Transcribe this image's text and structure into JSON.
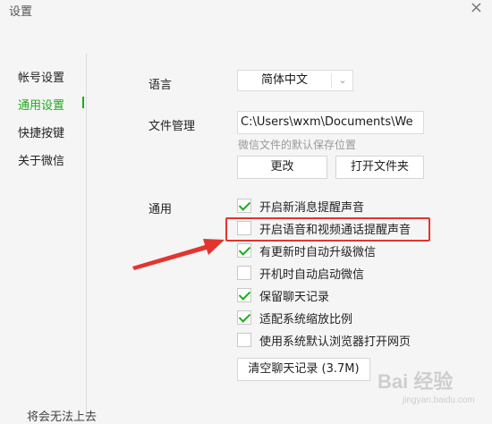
{
  "window": {
    "title": "设置",
    "close_glyph": "×"
  },
  "sidebar": {
    "items": [
      {
        "label": "帐号设置",
        "active": false
      },
      {
        "label": "通用设置",
        "active": true
      },
      {
        "label": "快捷按键",
        "active": false
      },
      {
        "label": "关于微信",
        "active": false
      }
    ]
  },
  "language": {
    "label": "语言",
    "selected": "简体中文",
    "arrow_icon": "chevron-down-icon"
  },
  "file_management": {
    "label": "文件管理",
    "path": "C:\\Users\\wxm\\Documents\\We",
    "hint": "微信文件的默认保存位置",
    "change_button": "更改",
    "open_folder_button": "打开文件夹"
  },
  "general": {
    "label": "通用",
    "options": [
      {
        "label": "开启新消息提醒声音",
        "checked": true
      },
      {
        "label": "开启语音和视频通话提醒声音",
        "checked": false
      },
      {
        "label": "有更新时自动升级微信",
        "checked": true
      },
      {
        "label": "开机时自动启动微信",
        "checked": false
      },
      {
        "label": "保留聊天记录",
        "checked": true
      },
      {
        "label": "适配系统缩放比例",
        "checked": true
      },
      {
        "label": "使用系统默认浏览器打开网页",
        "checked": false
      }
    ],
    "clear_button": "清空聊天记录 (3.7M)"
  },
  "annotation": {
    "highlight_color": "#e3342f",
    "target": "开启语音和视频通话提醒声音"
  },
  "colors": {
    "accent": "#1aad19",
    "annotation": "#e3342f"
  },
  "cut_off_text": "将会无法上去",
  "watermark": {
    "text": "Bai 经验",
    "sub": "jingyan.baidu.com"
  }
}
